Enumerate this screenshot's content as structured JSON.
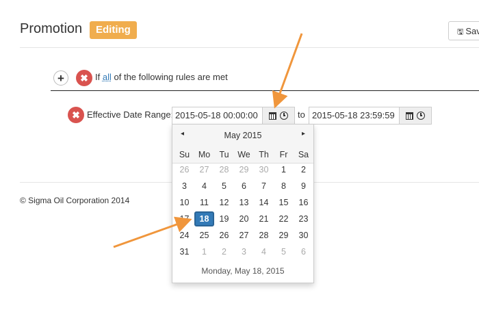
{
  "header": {
    "title": "Promotion",
    "status_badge": "Editing",
    "save_label": "Sav",
    "save_icon": "floppy-disk-icon"
  },
  "rules": {
    "prefix": "If",
    "quantifier": "all",
    "suffix": "of the following rules are met"
  },
  "field": {
    "label": "Effective Date Range:",
    "start_value": "2015-05-18 00:00:00",
    "to_label": "to",
    "end_value": "2015-05-18 23:59:59"
  },
  "calendar": {
    "month_label": "May 2015",
    "prev_label": "◂",
    "next_label": "▸",
    "weekdays": [
      "Su",
      "Mo",
      "Tu",
      "We",
      "Th",
      "Fr",
      "Sa"
    ],
    "weeks": [
      [
        "26",
        "27",
        "28",
        "29",
        "30",
        "1",
        "2"
      ],
      [
        "3",
        "4",
        "5",
        "6",
        "7",
        "8",
        "9"
      ],
      [
        "10",
        "11",
        "12",
        "13",
        "14",
        "15",
        "16"
      ],
      [
        "17",
        "18",
        "19",
        "20",
        "21",
        "22",
        "23"
      ],
      [
        "24",
        "25",
        "26",
        "27",
        "28",
        "29",
        "30"
      ],
      [
        "31",
        "1",
        "2",
        "3",
        "4",
        "5",
        "6"
      ]
    ],
    "selected_day": "18",
    "footer_text": "Monday, May 18, 2015"
  },
  "footer": {
    "copyright": "© Sigma Oil Corporation 2014"
  },
  "colors": {
    "badge": "#f0ad4e",
    "remove_button": "#d9534f",
    "selected_day": "#337ab7",
    "annotation_arrow": "#f0963c"
  }
}
